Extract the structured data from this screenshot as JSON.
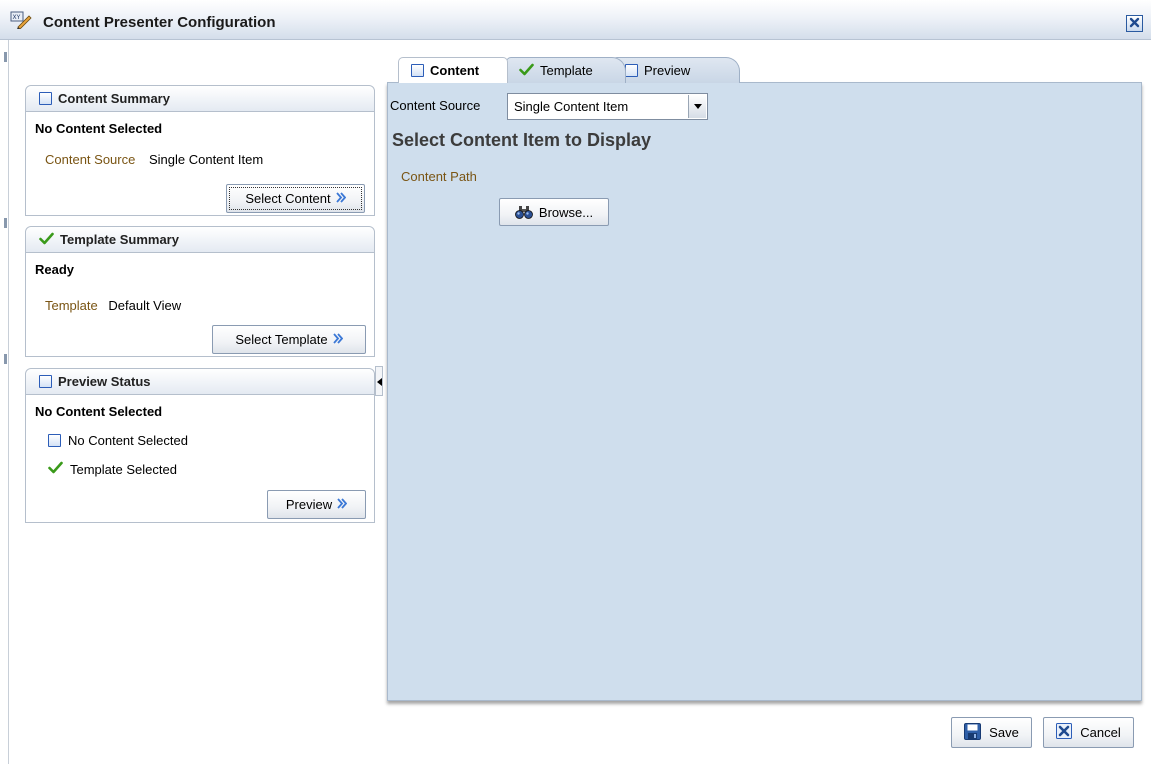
{
  "window": {
    "title": "Content Presenter Configuration",
    "title_icon": "edit-pencil-icon",
    "close_icon": "close-icon"
  },
  "content_summary": {
    "title": "Content Summary",
    "status": "No Content Selected",
    "source_label": "Content Source",
    "source_value": "Single Content Item",
    "button": "Select Content"
  },
  "template_summary": {
    "title": "Template Summary",
    "status": "Ready",
    "template_label": "Template",
    "template_value": "Default View",
    "button": "Select Template"
  },
  "preview_status": {
    "title": "Preview Status",
    "status": "No Content Selected",
    "items": [
      {
        "icon": "checkbox-icon",
        "label": "No Content Selected"
      },
      {
        "icon": "checkmark-icon",
        "label": "Template Selected"
      }
    ],
    "button": "Preview"
  },
  "tabs": [
    {
      "label": "Content",
      "icon": "checkbox-icon",
      "active": true
    },
    {
      "label": "Template",
      "icon": "checkmark-icon",
      "active": false
    },
    {
      "label": "Preview",
      "icon": "checkbox-icon",
      "active": false
    }
  ],
  "content_tab": {
    "source_label": "Content Source",
    "source_selected": "Single Content Item",
    "section_title": "Select Content Item to Display",
    "path_label": "Content Path",
    "browse_button": "Browse..."
  },
  "footer": {
    "save": "Save",
    "cancel": "Cancel"
  },
  "colors": {
    "accent_blue": "#2c5db8",
    "label_brown": "#7a5514",
    "content_bg": "#cfdeed",
    "check_green": "#3a9a1a"
  }
}
